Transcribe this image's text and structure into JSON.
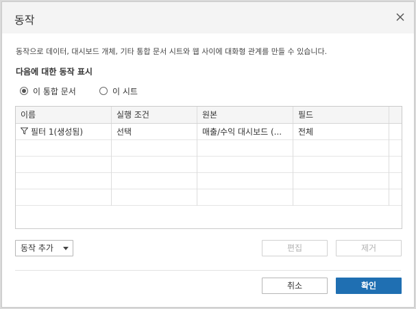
{
  "dialog": {
    "title": "동작",
    "description": "동작으로 데이터, 대시보드 개체, 기타 통합 문서 시트와 웹 사이에 대화형 관계를 만들 수 있습니다.",
    "show_actions_for": "다음에 대한 동작 표시"
  },
  "scope": {
    "options": [
      {
        "label": "이 통합 문서",
        "checked": true
      },
      {
        "label": "이 시트",
        "checked": false
      }
    ]
  },
  "table": {
    "columns": [
      "이름",
      "실행 조건",
      "원본",
      "필드"
    ],
    "rows": [
      {
        "name": "필터 1(생성됨)",
        "icon": "filter-icon",
        "run_on": "선택",
        "source": "매출/수익 대시보드 (...",
        "fields": "전체"
      }
    ]
  },
  "buttons": {
    "add_action": "동작 추가",
    "edit": "편집",
    "remove": "제거",
    "cancel": "취소",
    "ok": "확인"
  },
  "colors": {
    "primary": "#1f6fb2",
    "header_bg": "#f4f4f4"
  }
}
